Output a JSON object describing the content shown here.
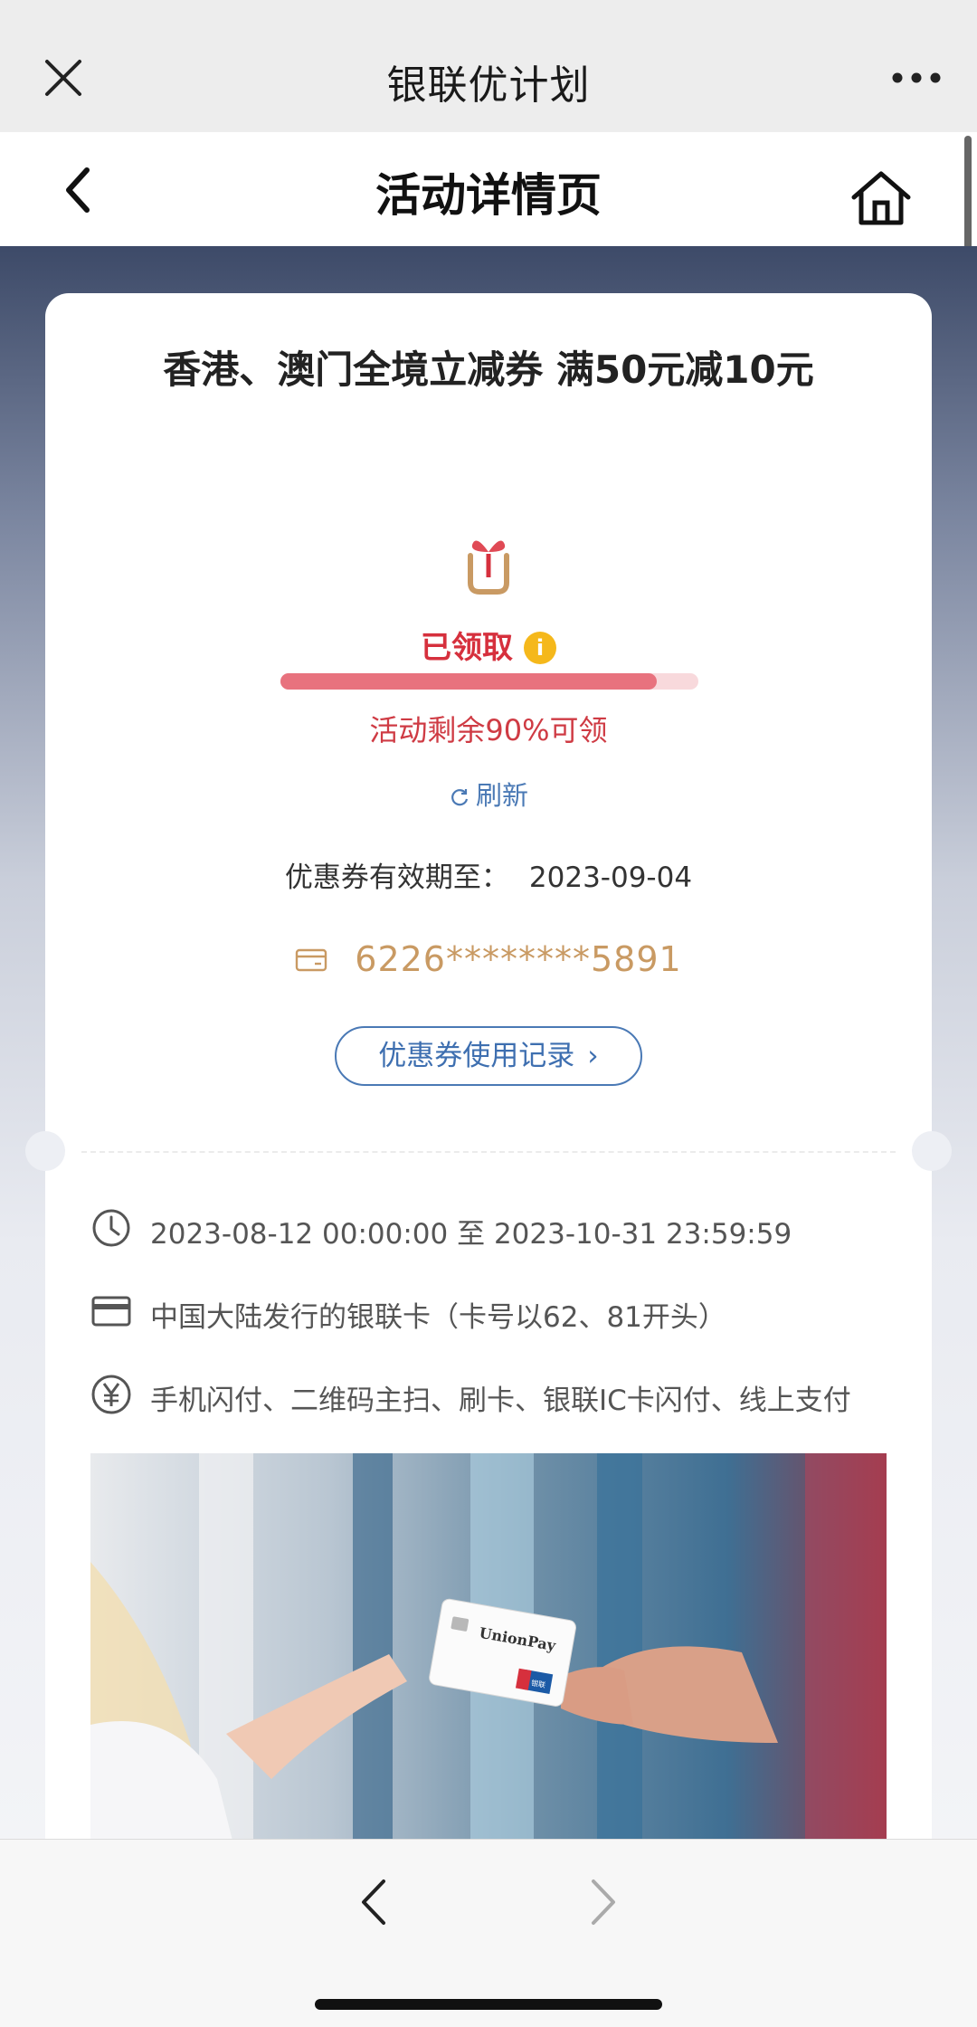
{
  "wechat_bar": {
    "title": "银联优计划",
    "close_icon": "close-icon",
    "more_icon": "more-dots-icon"
  },
  "header": {
    "title": "活动详情页",
    "back_icon": "chevron-left-icon",
    "home_icon": "home-icon"
  },
  "coupon": {
    "title": "香港、澳门全境立减券 满50元减10元",
    "gift_icon": "gift-icon",
    "status": "已领取",
    "info_icon_glyph": "i",
    "progress_percent": 90,
    "remain_text": "活动剩余90%可领",
    "refresh_label": "刷新",
    "valid_label": "优惠券有效期至：",
    "valid_date": "2023-09-04",
    "card_number": "6226********5891",
    "record_button": "优惠券使用记录",
    "record_chevron": "›"
  },
  "details": [
    {
      "icon": "clock-icon",
      "text": "2023-08-12 00:00:00 至 2023-10-31 23:59:59"
    },
    {
      "icon": "bank-card-icon",
      "text": "中国大陆发行的银联卡（卡号以62、81开头）"
    },
    {
      "icon": "yuan-icon",
      "text": "手机闪付、二维码主扫、刷卡、银联IC卡闪付、线上支付"
    }
  ],
  "promo_image": {
    "card_brand": "UnionPay",
    "card_badge": "银联"
  },
  "colors": {
    "accent_red": "#d6303d",
    "accent_blue": "#4a79b5",
    "card_gold": "#c99a63",
    "info_yellow": "#f5b81b"
  }
}
